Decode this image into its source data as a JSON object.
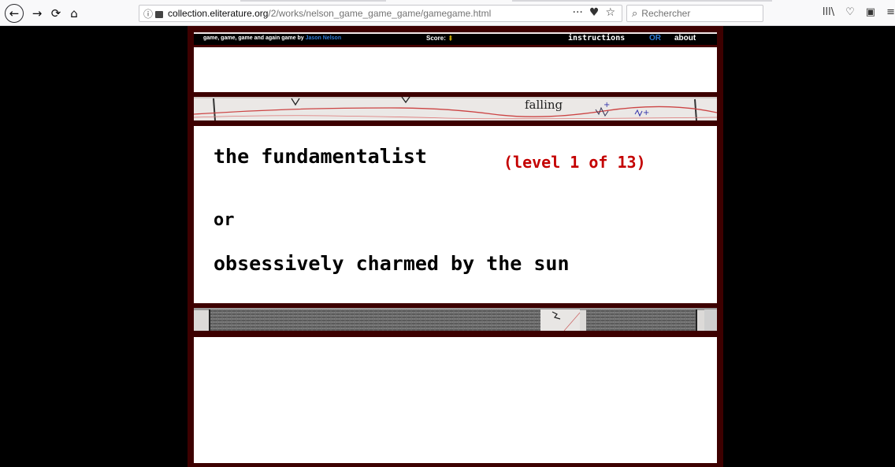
{
  "browser": {
    "nav": {
      "back_icon": "←",
      "forward_icon": "→",
      "reload_icon": "⟳",
      "home_icon": "⌂"
    },
    "url": {
      "domain": "collection.eliterature.org",
      "path": "/2/works/nelson_game_game_game/gamegame.html"
    },
    "url_actions": [
      "···",
      "♥",
      "☆"
    ],
    "search_placeholder": "Rechercher",
    "right_icons": [
      "lll\\",
      "♡",
      "▣",
      "≡"
    ]
  },
  "game": {
    "header": {
      "title": "game, game, game and again game",
      "by": "by",
      "author": "Jason Nelson",
      "score_label": "Score:",
      "score_icon": "‡",
      "instructions": "instructions",
      "or_separator": "OR",
      "about": "about"
    },
    "strip1_text": "falling",
    "level": {
      "title": "the fundamentalist",
      "badge": "(level 1 of 13)",
      "connector": "or",
      "subtitle": "obsessively charmed by the sun"
    }
  },
  "colors": {
    "frame": "#3d0000",
    "level_badge": "#c40000",
    "author_link": "#2e7bd6"
  }
}
